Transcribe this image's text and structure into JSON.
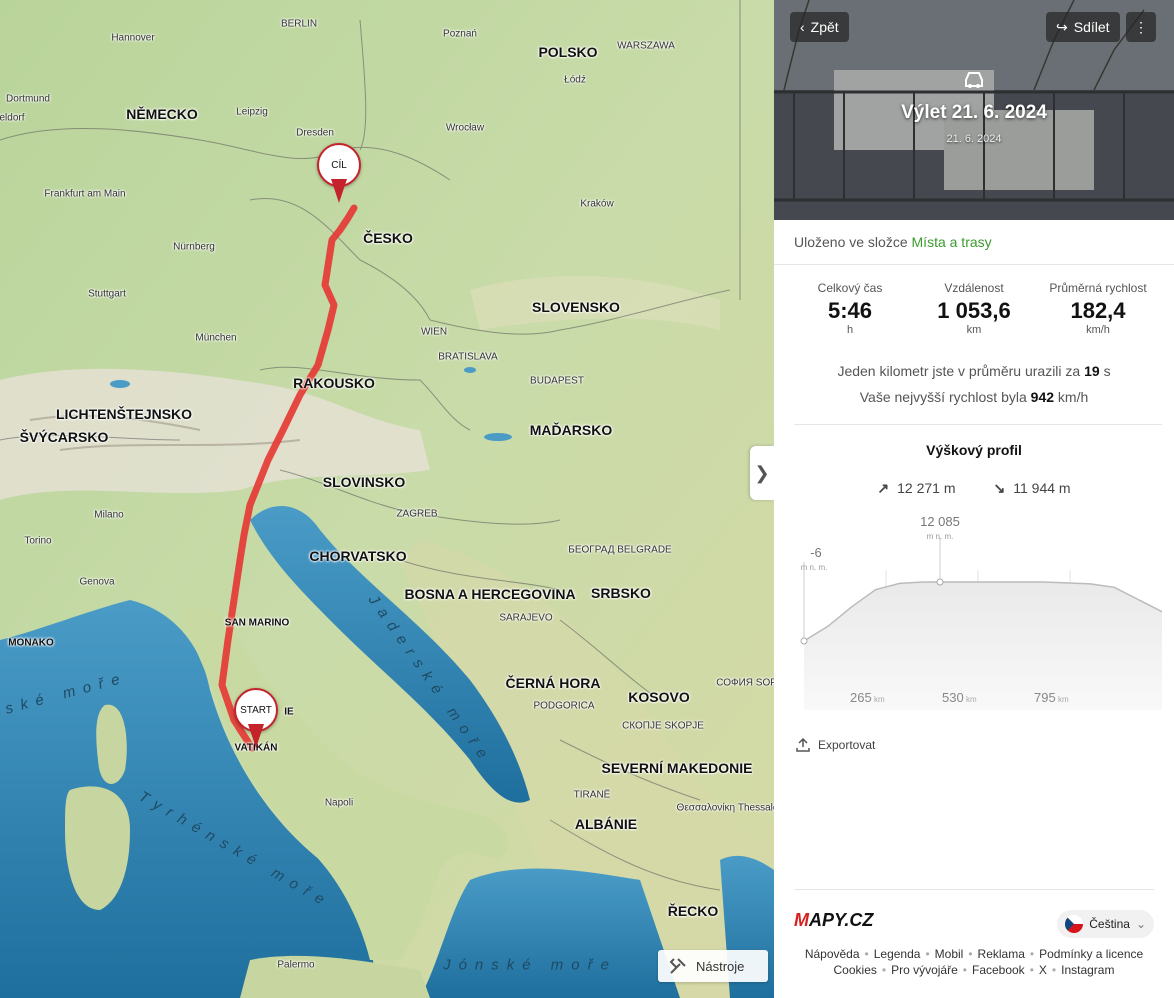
{
  "map": {
    "countries": [
      "NĚMECKO",
      "POLSKO",
      "ČESKO",
      "SLOVENSKO",
      "RAKOUSKO",
      "MAĎARSKO",
      "LICHTENŠTEJNSKO",
      "ŠVÝCARSKO",
      "SLOVINSKO",
      "CHORVATSKO",
      "BOSNA A HERCEGOVINA",
      "SRBSKO",
      "ČERNÁ HORA",
      "KOSOVO",
      "SEVERNÍ MAKEDONIE",
      "ALBÁNIE",
      "ŘECKO",
      "MONAKO",
      "SAN MARINO",
      "VATIKÁN",
      "IE"
    ],
    "cities": [
      "Hannover",
      "BERLIN",
      "Poznań",
      "WARSZAWA",
      "Łódź",
      "Dortmund",
      "Leipzig",
      "Dresden",
      "Wrocław",
      "Frankfurt am Main",
      "Kraków",
      "Nürnberg",
      "Stuttgart",
      "München",
      "WIEN",
      "BRATISLAVA",
      "BUDAPEST",
      "Milano",
      "Torino",
      "ZAGREB",
      "БЕОГРАД BELGRADE",
      "Genova",
      "SARAJEVO",
      "PODGORICA",
      "СОФИЯ SOFIA",
      "СКОПЈЕ SKOPJE",
      "TIRANË",
      "Napoli",
      "Palermo",
      "Θεσσαλονίκη Thessaloniki",
      "eldorf"
    ],
    "seas": [
      "Jaderské moře",
      "Tyrhénské moře",
      "Jónské moře",
      "rské moře"
    ],
    "pins": {
      "start": "START",
      "finish": "CÍL"
    },
    "tools_label": "Nástroje",
    "toggle_glyph": "❯",
    "route_color": "#e53935"
  },
  "panel": {
    "back_label": "Zpět",
    "share_label": "Sdílet",
    "more_glyph": "⋮",
    "title": "Výlet 21. 6. 2024",
    "date": "21. 6. 2024",
    "saved_prefix": "Uloženo ve složce",
    "saved_folder": "Místa a trasy",
    "stats": [
      {
        "label": "Celkový čas",
        "value": "5:46",
        "unit": "h"
      },
      {
        "label": "Vzdálenost",
        "value": "1 053,6",
        "unit": "km"
      },
      {
        "label": "Průměrná rychlost",
        "value": "182,4",
        "unit": "km/h"
      }
    ],
    "fact1_prefix": "Jeden kilometr jste v průměru urazili za",
    "fact1_value": "19",
    "fact1_unit": "s",
    "fact2_prefix": "Vaše nejvyšší rychlost byla",
    "fact2_value": "942",
    "fact2_unit": "km/h",
    "profile": {
      "title": "Výškový profil",
      "ascent": "12 271 m",
      "descent": "11 944 m",
      "max_value": "12 085",
      "max_unit": "m n. m.",
      "min_value": "-6",
      "min_unit": "m n. m.",
      "ticks": [
        {
          "value": "265",
          "unit": "km"
        },
        {
          "value": "530",
          "unit": "km"
        },
        {
          "value": "795",
          "unit": "km"
        }
      ],
      "elevation_m": [
        -6,
        3000,
        7000,
        10500,
        11800,
        12085,
        12085,
        12085,
        12085,
        12085,
        12085,
        11900,
        11700,
        11000,
        8500,
        6000
      ]
    },
    "export_label": "Exportovat",
    "language": "Čeština",
    "logo": "MAPY.CZ",
    "footer_links_row1": [
      "Nápověda",
      "Legenda",
      "Mobil",
      "Reklama",
      "Podmínky a licence"
    ],
    "footer_links_row2": [
      "Cookies",
      "Pro vývojáře",
      "Facebook",
      "X",
      "Instagram"
    ]
  }
}
